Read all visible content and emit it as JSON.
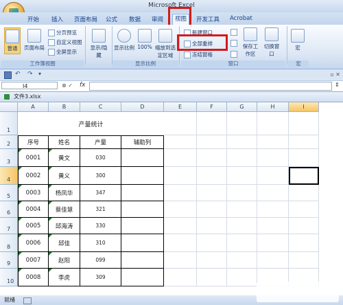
{
  "app": {
    "title": "Microsoft Excel"
  },
  "tabs": [
    "开始",
    "插入",
    "页面布局",
    "公式",
    "数据",
    "审阅",
    "视图",
    "开发工具",
    "Acrobat"
  ],
  "ribbon": {
    "workbook_views": {
      "label": "工作簿视图",
      "normal": "普通",
      "page_layout": "页面布局",
      "page_break_preview": "分页预览",
      "custom_views": "自定义视图",
      "full_screen": "全屏显示"
    },
    "show_hide": {
      "label": "显示/隐藏"
    },
    "zoom": {
      "label": "显示比例",
      "zoom_btn": "显示比例",
      "hundred": "100%",
      "zoom_to_selection": "缩放到选定区域"
    },
    "window": {
      "label": "窗口",
      "new_window": "新建窗口",
      "arrange_all": "全部重排",
      "freeze_panes": "冻结窗格",
      "save_workspace": "保存工作区",
      "switch_windows": "切换窗口"
    },
    "macros": {
      "label": "宏",
      "macros_btn": "宏"
    }
  },
  "formula_bar": {
    "name_box": "I4",
    "fx": "fx",
    "value": ""
  },
  "document": {
    "filename": "文件3.xlsx"
  },
  "sheet": {
    "columns": [
      "A",
      "B",
      "C",
      "D",
      "E",
      "F",
      "G",
      "H",
      "I"
    ],
    "rows": [
      "1",
      "2",
      "3",
      "4",
      "5",
      "6",
      "7",
      "8",
      "9",
      "10"
    ],
    "title": "产量统计",
    "headers": [
      "序号",
      "姓名",
      "产量",
      "辅助列"
    ],
    "data": [
      [
        "0001",
        "黄文",
        "030"
      ],
      [
        "0002",
        "黄义",
        "300"
      ],
      [
        "0003",
        "杨凤华",
        "347"
      ],
      [
        "0004",
        "蔡佳慧",
        "321"
      ],
      [
        "0005",
        "邱海涛",
        "330"
      ],
      [
        "0006",
        "邱佳",
        "310"
      ],
      [
        "0007",
        "赵阳",
        "099"
      ],
      [
        "0008",
        "李虎",
        "309"
      ]
    ],
    "selected_cell": "I4"
  },
  "status": {
    "ready": "就绪"
  },
  "colors": {
    "highlight": "#d11b1b",
    "accent": "#15428b"
  }
}
